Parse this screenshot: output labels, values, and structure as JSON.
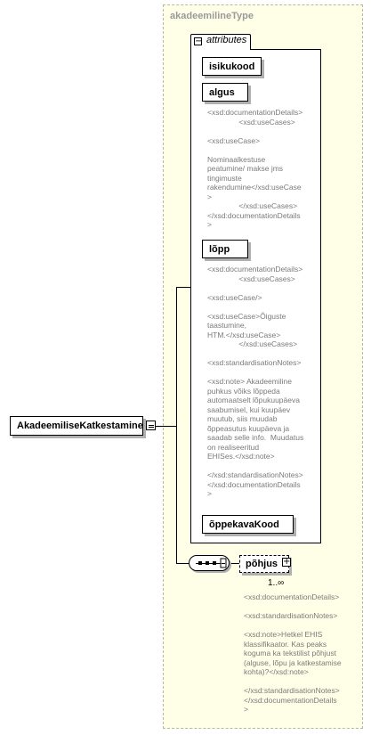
{
  "type_name": "akadeemilineType",
  "attributes_label": "attributes",
  "root_element": "AkadeemiliseKatkestamine",
  "attributes": [
    {
      "name": "isikukood"
    },
    {
      "name": "algus"
    },
    {
      "name": "lõpp"
    },
    {
      "name": "õppekavaKood"
    }
  ],
  "docs": {
    "algus": "<xsd:documentationDetails>\n               <xsd:useCases>\n\n<xsd:useCase>\n\nNominaalkestuse\npeatumine/ makse jms\ntingimuste\nrakendumine</xsd:useCase\n>\n               </xsd:useCases>\n</xsd:documentationDetails\n>",
    "lopp": "<xsd:documentationDetails>\n               <xsd:useCases>\n\n<xsd:useCase/>\n\n<xsd:useCase>Õiguste\ntaastumine,\nHTM.</xsd:useCase>\n               </xsd:useCases>\n\n<xsd:standardisationNotes>\n\n<xsd:note> Akadeemiline\npuhkus võiks lõppeda\nautomaatselt lõpukuupäeva\nsaabumisel, kui kuupäev\nmuutub, siis muudab\nõppeasutus kuupäeva ja\nsaadab selle info.  Muudatus\non realiseeritud\nEHISes.</xsd:note>\n\n</xsd:standardisationNotes>\n</xsd:documentationDetails\n>",
    "pohjus": "<xsd:documentationDetails>\n\n<xsd:standardisationNotes>\n\n<xsd:note>Hetkel EHIS\nklassifikaator. Kas peaks\nkoguma ka tekstilist põhjust\n(alguse, lõpu ja katkestamise\nkohta)?</xsd:note>\n\n</xsd:standardisationNotes>\n</xsd:documentationDetails\n>"
  },
  "sequence_element": "põhjus",
  "sequence_occurrence": "1..∞",
  "icons": {
    "collapse": "minus-box-icon",
    "expand": "plus-box-icon",
    "sequence": "sequence-compositor-icon"
  }
}
